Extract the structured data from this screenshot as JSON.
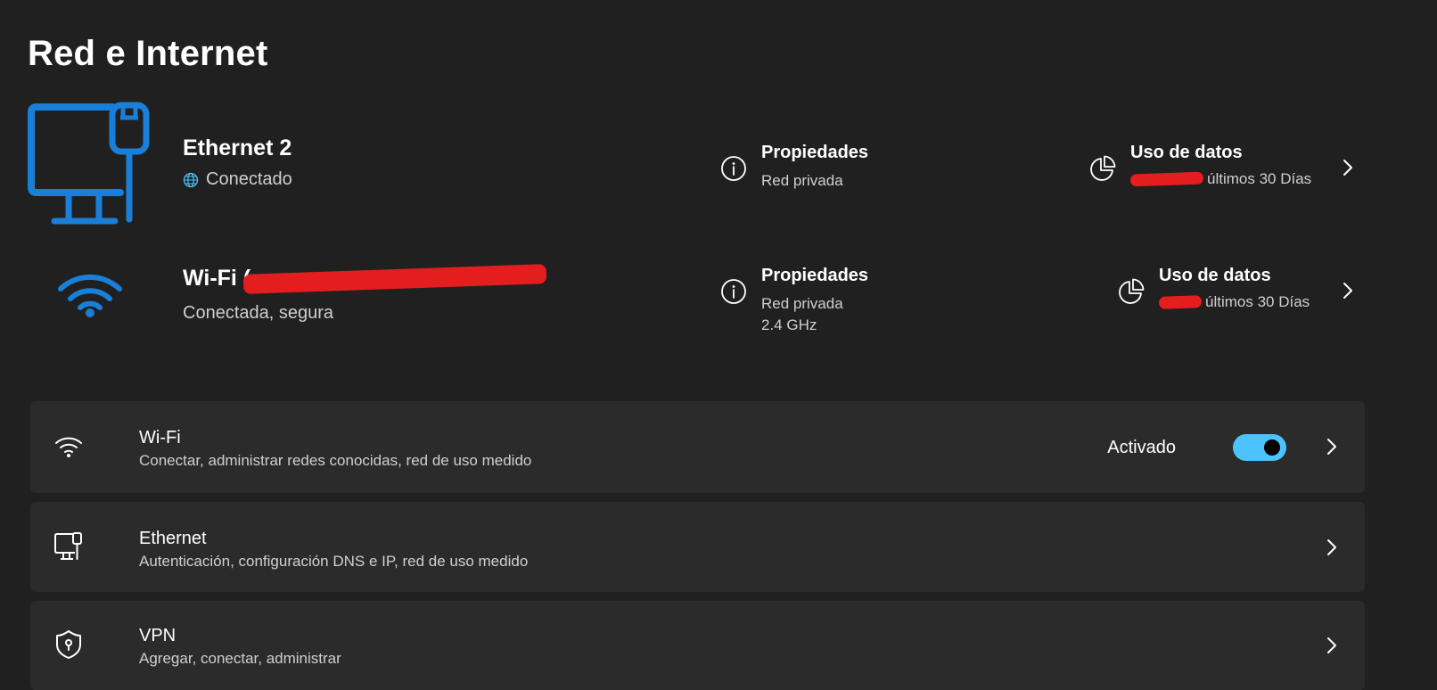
{
  "page": {
    "title": "Red e Internet"
  },
  "connections": [
    {
      "name": "Ethernet 2",
      "status": "Conectado",
      "icon": "ethernet-pc-icon",
      "properties_label": "Propiedades",
      "properties_lines": [
        "Red privada"
      ],
      "usage_label": "Uso de datos",
      "usage_suffix": "últimos 30 Días"
    },
    {
      "name": "Wi-Fi (",
      "status": "Conectada, segura",
      "icon": "wifi-icon",
      "properties_label": "Propiedades",
      "properties_lines": [
        "Red privada",
        "2.4 GHz"
      ],
      "usage_label": "Uso de datos",
      "usage_suffix": "últimos 30 Días"
    }
  ],
  "cards": [
    {
      "title": "Wi-Fi",
      "description": "Conectar, administrar redes conocidas, red de uso medido",
      "icon": "wifi-icon",
      "toggle_label": "Activado",
      "toggle_on": true
    },
    {
      "title": "Ethernet",
      "description": "Autenticación, configuración DNS e IP, red de uso medido",
      "icon": "ethernet-icon"
    },
    {
      "title": "VPN",
      "description": "Agregar, conectar, administrar",
      "icon": "shield-icon"
    }
  ],
  "colors": {
    "background": "#202020",
    "card": "#2b2b2b",
    "accent": "#4cc2ff",
    "icon_blue": "#1a7fd8",
    "redaction": "#e41e1e"
  }
}
